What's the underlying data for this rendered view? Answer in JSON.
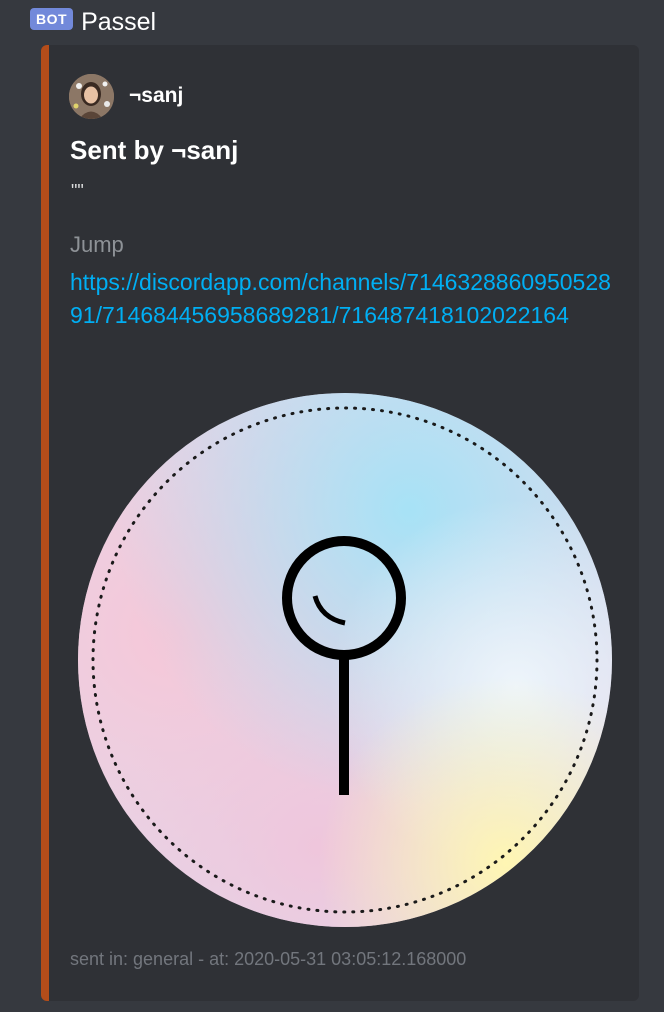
{
  "message": {
    "bot_tag": "BOT",
    "bot_name": "Passel"
  },
  "embed": {
    "accent_color": "#b44d1a",
    "author": {
      "name": "¬sanj",
      "avatar_icon": "user-avatar"
    },
    "title": "Sent by ¬sanj",
    "description": "\"\"",
    "field": {
      "name": "Jump",
      "value": "https://discordapp.com/channels/714632886095052891/714684456958689281/716487418102022164"
    },
    "image": {
      "icon": "lollipop-logo",
      "colors": [
        "#f3c6d6",
        "#a9e3f5",
        "#fdf4b6",
        "#e8d9ee"
      ]
    },
    "footer": "sent in: general - at: 2020-05-31 03:05:12.168000"
  },
  "colors": {
    "background": "#36393f",
    "embed_background": "#2f3136",
    "link": "#00aff4",
    "bot_tag": "#7289da"
  }
}
